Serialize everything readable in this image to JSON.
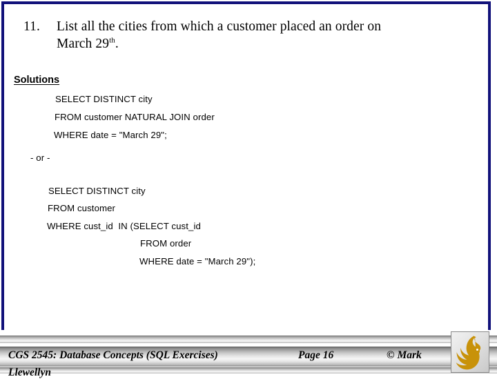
{
  "slide": {
    "border_color": "#11117a",
    "background": "#ffffff"
  },
  "title": {
    "number": "11.",
    "line1": "List all the cities from which a customer placed an order on",
    "line2_prefix": "March 29",
    "line2_sup": "th",
    "line2_suffix": "."
  },
  "solutions": {
    "heading": "Solutions"
  },
  "query1": {
    "line1": "SELECT DISTINCT city",
    "line2": "FROM customer NATURAL JOIN order",
    "line3": "WHERE date = \"March 29\";"
  },
  "separator": {
    "text": "- or -"
  },
  "query2": {
    "line1": "SELECT DISTINCT city",
    "line2": "FROM customer",
    "line3": "WHERE cust_id  IN (SELECT cust_id",
    "line4": "FROM order",
    "line5": "WHERE date = \"March 29\");"
  },
  "footer": {
    "course": "CGS 2545: Database Concepts  (SQL Exercises)",
    "page": "Page 16",
    "copyright": "© Mark",
    "author": "Llewellyn",
    "logo_name": "ucf-pegasus-logo",
    "logo_color": "#c8920a"
  }
}
